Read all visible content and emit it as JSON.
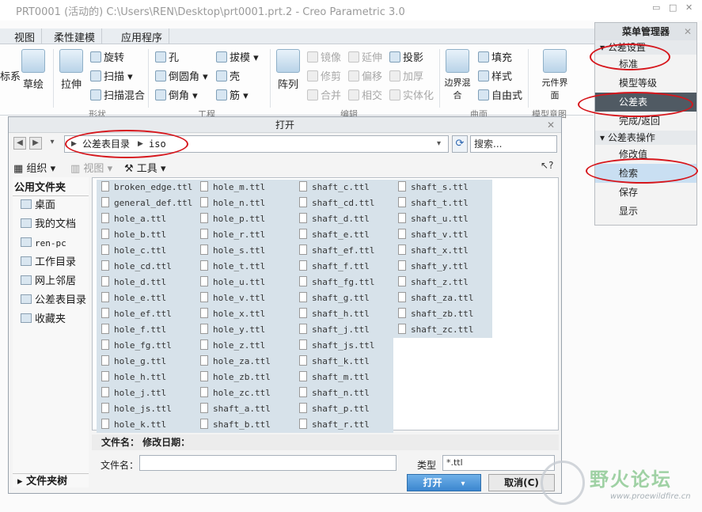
{
  "window": {
    "title": "PRT0001 (活动的) C:\\Users\\REN\\Desktop\\prt0001.prt.2 - Creo Parametric 3.0"
  },
  "ribbon": {
    "tabs": [
      "视图",
      "柔性建模",
      "应用程序"
    ],
    "labels": {
      "coord": "标系",
      "sketch": "草绘",
      "extrude": "拉伸",
      "revolve": "旋转",
      "sweep": "扫描",
      "swept_blend": "扫描混合",
      "hole": "孔",
      "round": "倒圆角",
      "chamfer": "倒角",
      "draft": "拔模",
      "shell": "壳",
      "rib": "筋",
      "pattern": "阵列",
      "mirror": "镜像",
      "trim": "修剪",
      "merge": "合并",
      "extend": "延伸",
      "offset": "偏移",
      "intersect": "相交",
      "project": "投影",
      "thicken": "加厚",
      "solidify": "实体化",
      "boundary_blend": "边界混合",
      "fill": "填充",
      "style": "样式",
      "freestyle": "自由式",
      "component_interface": "元件界面"
    },
    "groups": {
      "shape": "形状",
      "engineering": "工程",
      "editing": "编辑",
      "surfaces": "曲面",
      "model_intent": "模型意图"
    }
  },
  "menu_manager": {
    "title": "菜单管理器",
    "close": "✕",
    "section1": "公差设置",
    "items1": [
      "标准",
      "模型等级",
      "公差表",
      "完成/返回"
    ],
    "section2": "公差表操作",
    "items2": [
      "修改值",
      "检索",
      "保存",
      "显示"
    ]
  },
  "dialog": {
    "title": "打开",
    "close": "✕",
    "path": [
      "公差表目录",
      "iso"
    ],
    "search_placeholder": "搜索...",
    "toolbar": {
      "organize": "组织",
      "views": "视图",
      "tools": "工具",
      "help": "?"
    },
    "left_header": "公用文件夹",
    "left_items": [
      "桌面",
      "我的文档",
      "ren-pc",
      "工作目录",
      "网上邻居",
      "公差表目录",
      "收藏夹"
    ],
    "left_footer": "文件夹树",
    "files": [
      [
        "broken_edge.ttl",
        "general_def.ttl",
        "hole_a.ttl",
        "hole_b.ttl",
        "hole_c.ttl",
        "hole_cd.ttl",
        "hole_d.ttl",
        "hole_e.ttl",
        "hole_ef.ttl",
        "hole_f.ttl",
        "hole_fg.ttl",
        "hole_g.ttl",
        "hole_h.ttl",
        "hole_j.ttl",
        "hole_js.ttl",
        "hole_k.ttl"
      ],
      [
        "hole_m.ttl",
        "hole_n.ttl",
        "hole_p.ttl",
        "hole_r.ttl",
        "hole_s.ttl",
        "hole_t.ttl",
        "hole_u.ttl",
        "hole_v.ttl",
        "hole_x.ttl",
        "hole_y.ttl",
        "hole_z.ttl",
        "hole_za.ttl",
        "hole_zb.ttl",
        "hole_zc.ttl",
        "shaft_a.ttl",
        "shaft_b.ttl"
      ],
      [
        "shaft_c.ttl",
        "shaft_cd.ttl",
        "shaft_d.ttl",
        "shaft_e.ttl",
        "shaft_ef.ttl",
        "shaft_f.ttl",
        "shaft_fg.ttl",
        "shaft_g.ttl",
        "shaft_h.ttl",
        "shaft_j.ttl",
        "shaft_js.ttl",
        "shaft_k.ttl",
        "shaft_m.ttl",
        "shaft_n.ttl",
        "shaft_p.ttl",
        "shaft_r.ttl"
      ],
      [
        "shaft_s.ttl",
        "shaft_t.ttl",
        "shaft_u.ttl",
        "shaft_v.ttl",
        "shaft_x.ttl",
        "shaft_y.ttl",
        "shaft_z.ttl",
        "shaft_za.ttl",
        "shaft_zb.ttl",
        "shaft_zc.ttl"
      ]
    ],
    "detail_header": "文件名： 修改日期：",
    "filename_label": "文件名：",
    "filename_value": "",
    "type_label": "类型",
    "type_value": "*.ttl",
    "open_label": "打开",
    "cancel_label": "取消(C)"
  },
  "watermark": {
    "name": "野火论坛",
    "url": "www.proewildfire.cn"
  },
  "colors": {
    "annotation": "#d6161c",
    "selected_item": "#505a63",
    "file_bg": "#d7e2ea"
  }
}
